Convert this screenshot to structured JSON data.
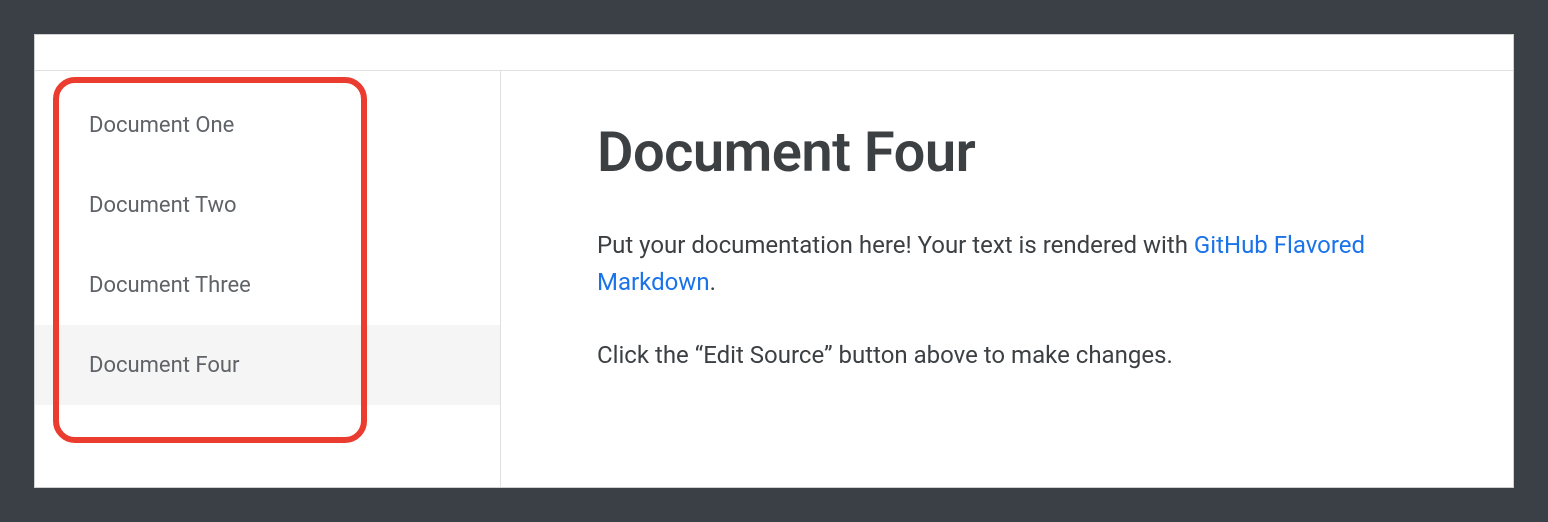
{
  "sidebar": {
    "items": [
      {
        "label": "Document One",
        "selected": false
      },
      {
        "label": "Document Two",
        "selected": false
      },
      {
        "label": "Document Three",
        "selected": false
      },
      {
        "label": "Document Four",
        "selected": true
      }
    ]
  },
  "main": {
    "title": "Document Four",
    "paragraph1_prefix": "Put your documentation here! Your text is rendered with ",
    "paragraph1_link": "GitHub Flavored Markdown",
    "paragraph1_suffix": ".",
    "paragraph2": "Click the “Edit Source” button above to make changes."
  },
  "annotation": {
    "highlight_color": "#eb3d2f"
  }
}
